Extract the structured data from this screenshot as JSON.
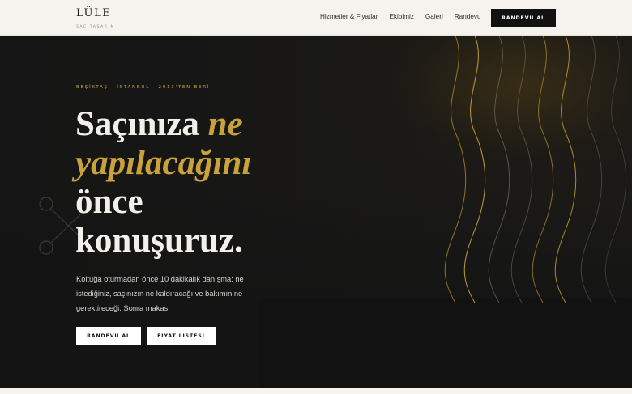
{
  "brand": {
    "name": "LÜLE",
    "tagline": "SAÇ TASARIM"
  },
  "nav": {
    "links": [
      "Hizmetler & Fiyatlar",
      "Ekibimiz",
      "Galeri",
      "Randevu"
    ],
    "cta_label": "RANDEVU AL"
  },
  "hero": {
    "eyebrow": "BEŞİKTAŞ · İSTANBUL · 2013'TEN BERİ",
    "headline": {
      "part1": "Saçınıza ",
      "accent1": "ne",
      "accent2": "yapılacağını",
      "part2": "önce",
      "part3": "konuşuruz."
    },
    "lede": "Koltuğa oturmadan önce 10 dakikalık danışma: ne istediğiniz, saçınızın ne kaldıracağı ve bakımın ne gerektireceği. Sonra makas.",
    "primary_button": "RANDEVU AL",
    "secondary_button": "FİYAT LİSTESİ"
  },
  "colors": {
    "accent": "#c9a23b",
    "dark": "#141414",
    "light": "#f6f3ee"
  },
  "icons": {
    "decoration": "scissors-icon"
  }
}
